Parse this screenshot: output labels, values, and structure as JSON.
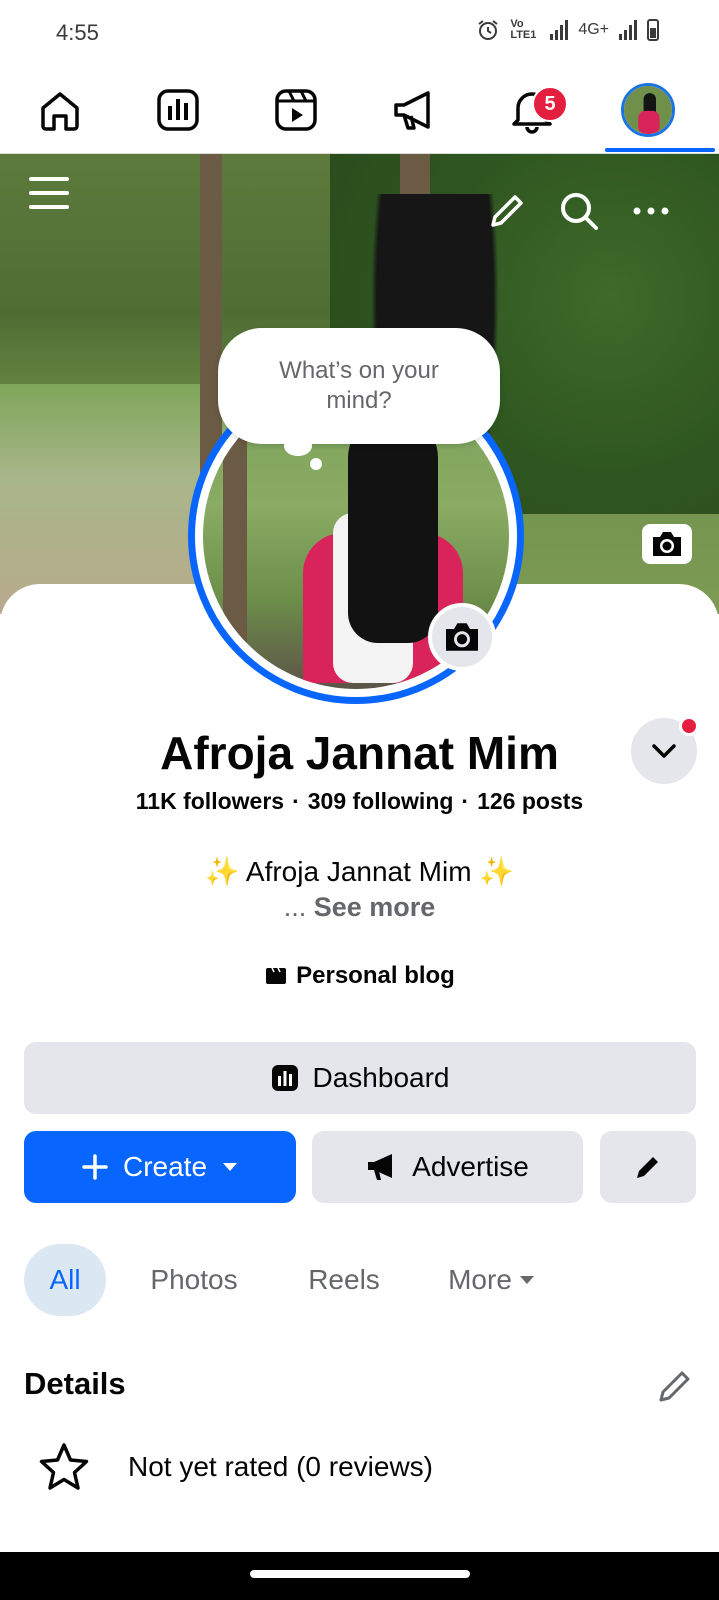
{
  "status_bar": {
    "time": "4:55",
    "network": "4G+",
    "carrier_tag": "Vo LTE1"
  },
  "top_nav": {
    "notifications_count": "5"
  },
  "cover": {
    "actions": [
      "menu",
      "edit",
      "search",
      "more"
    ]
  },
  "composer": {
    "placeholder": "What’s on your mind?"
  },
  "profile": {
    "name": "Afroja Jannat Mim",
    "followers": "11K followers",
    "following": "309 following",
    "posts": "126 posts",
    "separator": "·",
    "bio": "✨ Afroja Jannat Mim ✨",
    "see_more_prefix": "...",
    "see_more": "See more",
    "category": "Personal blog"
  },
  "actions": {
    "dashboard": "Dashboard",
    "create": "Create",
    "advertise": "Advertise"
  },
  "tabs": [
    {
      "label": "All",
      "active": true
    },
    {
      "label": "Photos",
      "active": false
    },
    {
      "label": "Reels",
      "active": false
    },
    {
      "label": "More",
      "active": false
    }
  ],
  "details": {
    "title": "Details",
    "rating": "Not yet rated (0 reviews)"
  },
  "colors": {
    "accent": "#0866ff",
    "badge": "#e41e3f",
    "button_gray": "#e4e6eb"
  }
}
